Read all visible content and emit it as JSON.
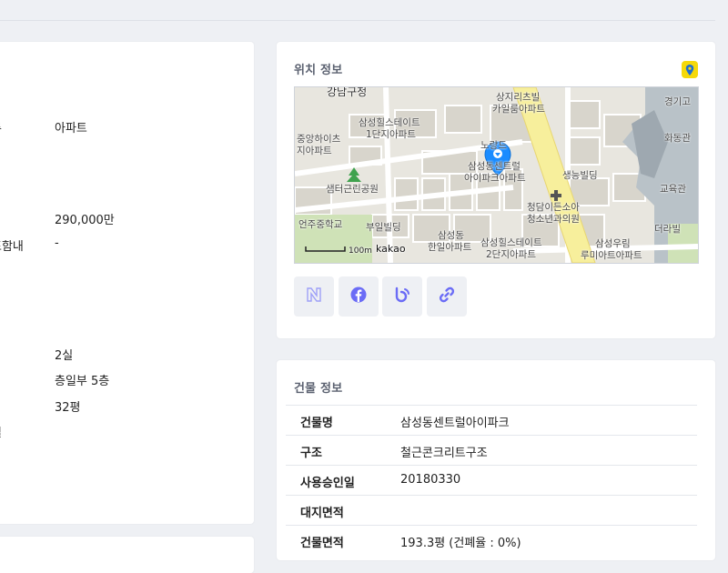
{
  "left_panel": {
    "rows": [
      {
        "key": "류",
        "value": "아파트"
      },
      {
        "key": "",
        "value": "290,000만"
      },
      {
        "key": "포함내",
        "value": "-"
      },
      {
        "key": "",
        "value": "2실"
      },
      {
        "key": "",
        "value": "층일부 5층"
      },
      {
        "key": "",
        "value": "32평"
      },
      {
        "key": "일",
        "value": ""
      }
    ]
  },
  "location": {
    "title": "위치 정보",
    "map": {
      "labels": [
        "강남구청",
        "상지리츠빌",
        "카일룸아파트",
        "경기고",
        "삼성힐스테이트",
        "1단지아파트",
        "중앙하이츠",
        "지아파트",
        "노랑드",
        "화동관",
        "삼성동센트럴",
        "아이파크아파트",
        "생능빌딩",
        "샘터근린공원",
        "교육관",
        "청담이든소아",
        "청소년과의원",
        "언주중학교",
        "부일빌딩",
        "삼성동",
        "한일아파트",
        "더라빌",
        "삼성힐스테이트",
        "2단지아파트",
        "삼성우림",
        "루미아트아파트"
      ],
      "scale_text": "100m",
      "provider": "kakao"
    },
    "share_icons": [
      "naver-icon",
      "facebook-icon",
      "blog-icon",
      "link-icon"
    ]
  },
  "building": {
    "title": "건물 정보",
    "rows": [
      {
        "key": "건물명",
        "value": "삼성동센트럴아이파크"
      },
      {
        "key": "구조",
        "value": "철근콘크리트구조"
      },
      {
        "key": "사용승인일",
        "value": "20180330"
      },
      {
        "key": "대지면적",
        "value": ""
      },
      {
        "key": "건물면적",
        "value": "193.3평 (건폐율 : 0%)"
      }
    ]
  },
  "colors": {
    "accent": "#6b6cf6",
    "pin": "#1a8cff",
    "badge": "#f5d90a",
    "road_yellow": "#f7ef9c"
  }
}
